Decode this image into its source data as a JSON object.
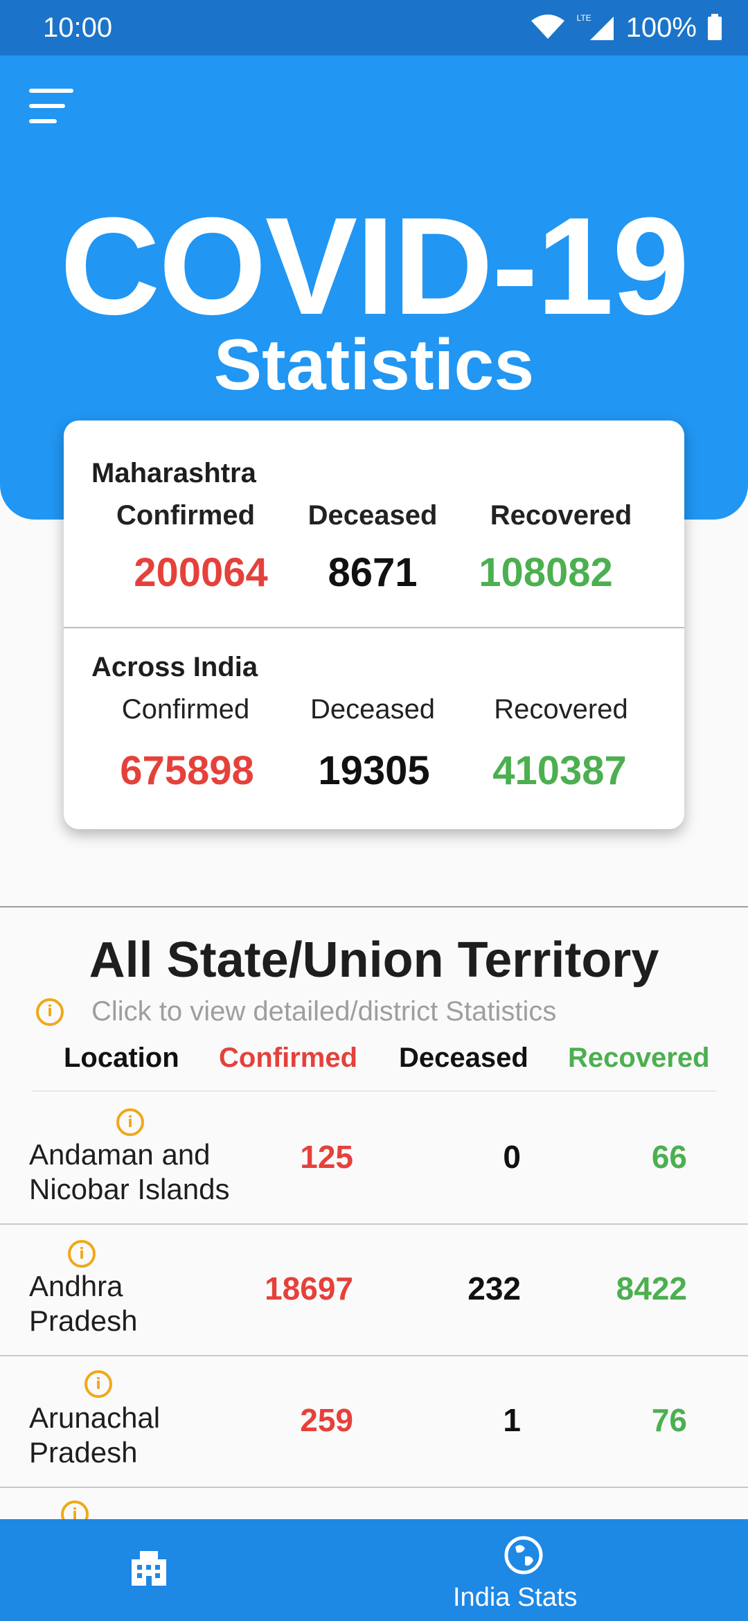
{
  "status_bar": {
    "time": "10:00",
    "network": "LTE",
    "battery": "100%"
  },
  "header": {
    "title": "COVID-19",
    "subtitle": "Statistics"
  },
  "summary": {
    "state": {
      "name": "Maharashtra",
      "labels": [
        "Confirmed",
        "Deceased",
        "Recovered"
      ],
      "confirmed": "200064",
      "deceased": "8671",
      "recovered": "108082"
    },
    "india": {
      "name": "Across India",
      "labels": [
        "Confirmed",
        "Deceased",
        "Recovered"
      ],
      "confirmed": "675898",
      "deceased": "19305",
      "recovered": "410387"
    }
  },
  "states_section": {
    "title": "All State/Union Territory",
    "hint": "Click to view detailed/district Statistics",
    "columns": [
      "Location",
      "Confirmed",
      "Deceased",
      "Recovered"
    ],
    "rows": [
      {
        "location_line1": "Andaman and",
        "location_line2": "Nicobar Islands",
        "confirmed": "125",
        "deceased": "0",
        "recovered": "66"
      },
      {
        "location_line1": "Andhra",
        "location_line2": "Pradesh",
        "confirmed": "18697",
        "deceased": "232",
        "recovered": "8422"
      },
      {
        "location_line1": "Arunachal",
        "location_line2": "Pradesh",
        "confirmed": "259",
        "deceased": "1",
        "recovered": "76"
      }
    ]
  },
  "bottom_nav": {
    "items": [
      {
        "icon": "building-icon",
        "label": ""
      },
      {
        "icon": "globe-icon",
        "label": "India Stats"
      }
    ]
  },
  "colors": {
    "primary": "#2196f3",
    "status_bar": "#1b74c9",
    "nav": "#1e88e5",
    "confirmed": "#e5413b",
    "recovered": "#4caf50",
    "info": "#f0a81a"
  }
}
